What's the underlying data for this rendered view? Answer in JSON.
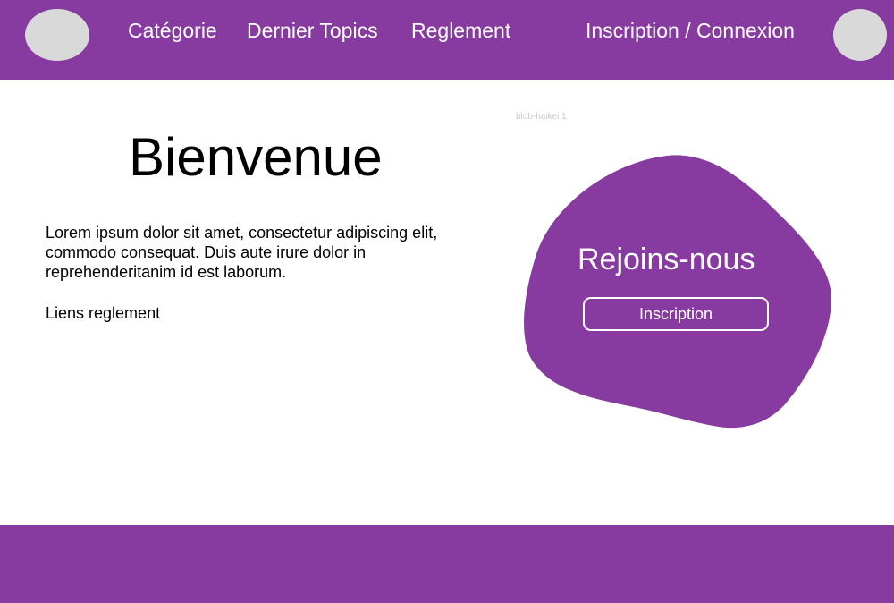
{
  "colors": {
    "brand": "#873ba0",
    "placeholder": "#d9d9d9",
    "text": "#000000",
    "on_brand": "#ffffff"
  },
  "header": {
    "nav": {
      "categorie": "Catégorie",
      "dernier_topics": "Dernier Topics",
      "reglement": "Reglement",
      "auth": "Inscription / Connexion"
    }
  },
  "main": {
    "title": "Bienvenue",
    "intro": "Lorem ipsum dolor sit amet, consectetur adipiscing elit, commodo consequat. Duis aute irure dolor in reprehenderitanim id est laborum.",
    "rules_link": "Liens reglement"
  },
  "cta": {
    "layer_label": "blob-haikei 1",
    "title": "Rejoins-nous",
    "button": "Inscription"
  }
}
